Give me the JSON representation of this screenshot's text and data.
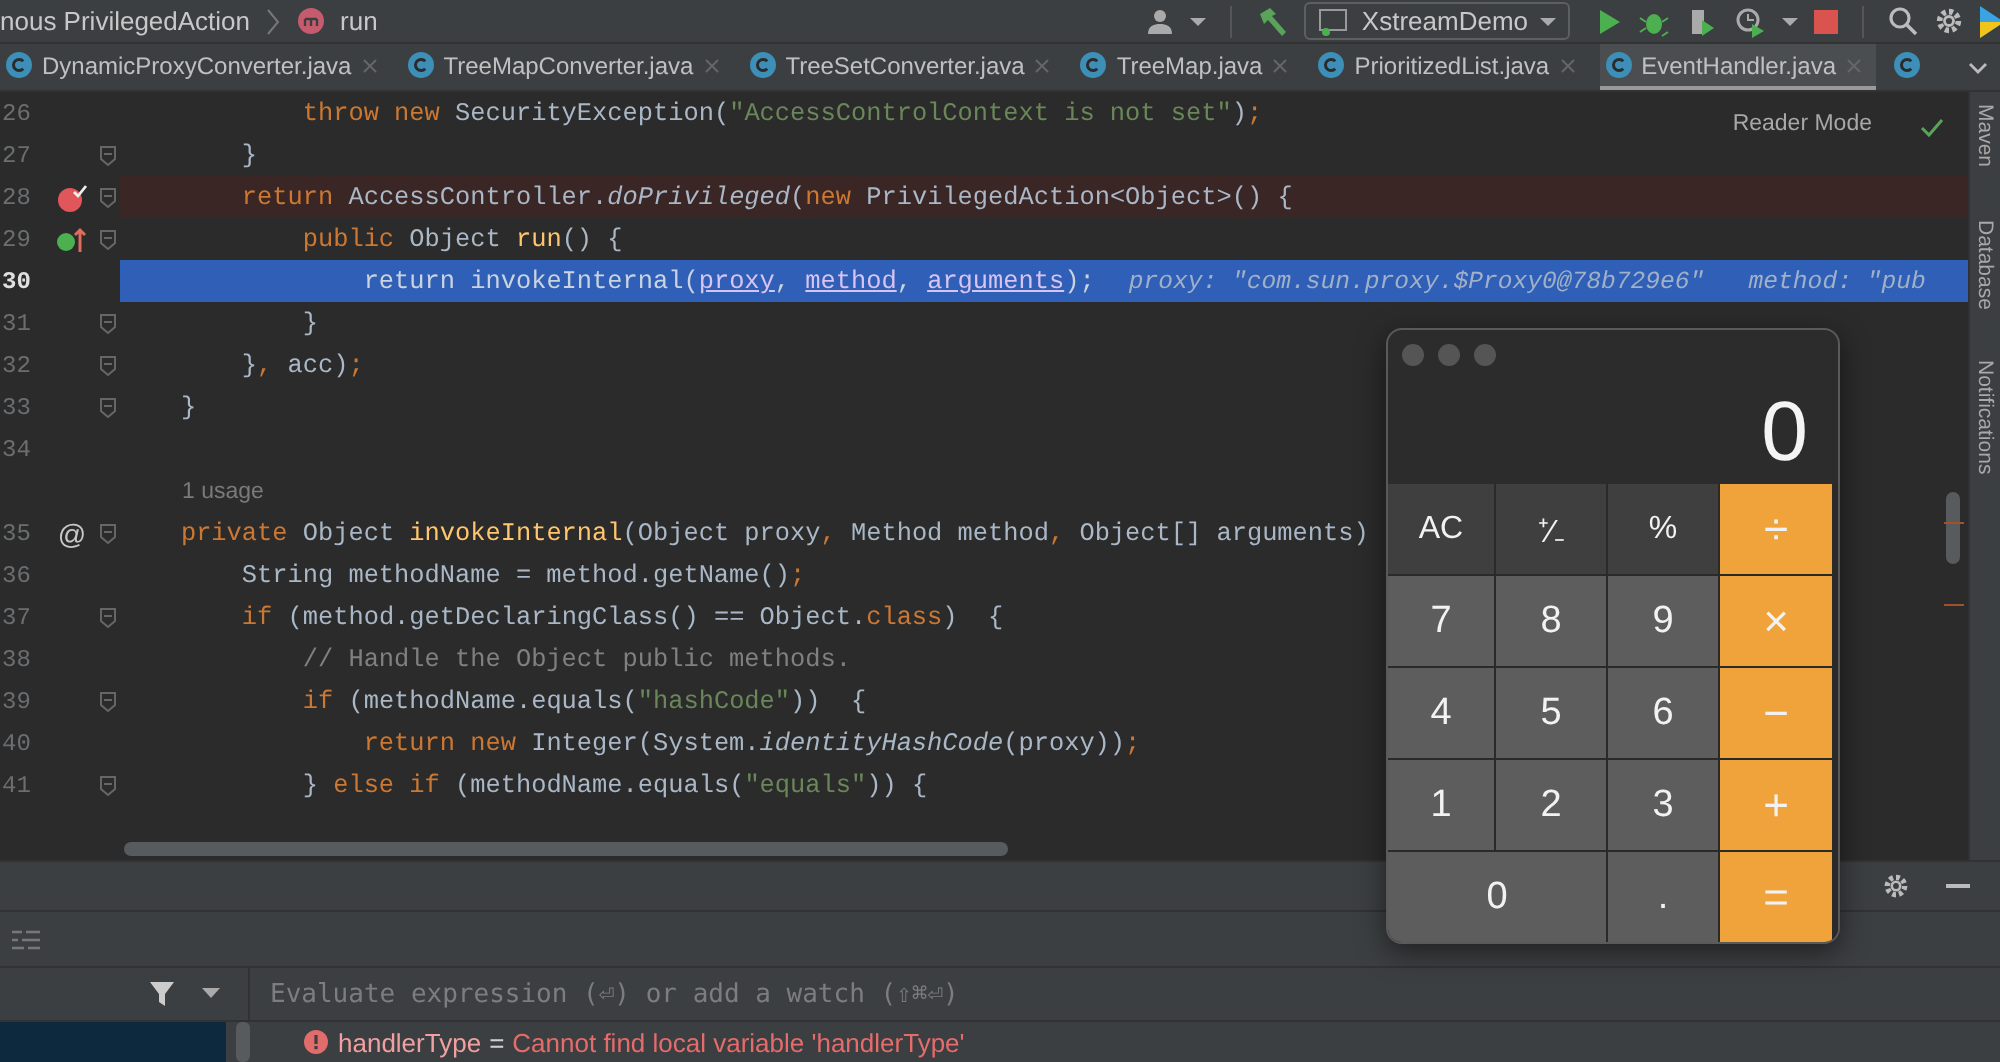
{
  "breadcrumb": [
    "nous PrivilegedAction",
    "run"
  ],
  "run_config": "XstreamDemo",
  "tabs": [
    {
      "label": "DynamicProxyConverter.java",
      "selected": false
    },
    {
      "label": "TreeMapConverter.java",
      "selected": false
    },
    {
      "label": "TreeSetConverter.java",
      "selected": false
    },
    {
      "label": "TreeMap.java",
      "selected": false
    },
    {
      "label": "PrioritizedList.java",
      "selected": false
    },
    {
      "label": "EventHandler.java",
      "selected": true
    }
  ],
  "reader_mode": "Reader Mode",
  "lines": [
    {
      "kind": "code",
      "number": "26",
      "fold": false,
      "tokens": [
        {
          "kind": "kw",
          "text": "            throw new "
        },
        {
          "kind": "txt",
          "text": "SecurityException("
        },
        {
          "kind": "str",
          "text": "\"AccessControlContext is not set\""
        },
        {
          "kind": "txt",
          "text": ")"
        },
        {
          "kind": "kw",
          "text": ";"
        }
      ]
    },
    {
      "kind": "code",
      "number": "27",
      "fold": true,
      "tokens": [
        {
          "kind": "txt",
          "text": "        }"
        }
      ]
    },
    {
      "kind": "breakpoint",
      "number": "28",
      "fold": true,
      "gutter": {
        "kind": "breakpoint"
      },
      "tokens": [
        {
          "kind": "kw",
          "text": "        return "
        },
        {
          "kind": "txt",
          "text": "AccessController."
        },
        {
          "kind": "it",
          "text": "doPrivileged"
        },
        {
          "kind": "txt",
          "text": "("
        },
        {
          "kind": "kw",
          "text": "new "
        },
        {
          "kind": "txt",
          "text": "PrivilegedAction<Object>() {"
        }
      ]
    },
    {
      "kind": "code",
      "number": "29",
      "fold": true,
      "gutter": {
        "kind": "override"
      },
      "tokens": [
        {
          "kind": "kw",
          "text": "            public "
        },
        {
          "kind": "txt",
          "text": "Object "
        },
        {
          "kind": "fn",
          "text": "run"
        },
        {
          "kind": "txt",
          "text": "() {"
        }
      ]
    },
    {
      "kind": "execution",
      "number": "30",
      "fold": false,
      "tokens": [
        {
          "kind": "kw",
          "text": "                return "
        },
        {
          "kind": "txt",
          "text": "invokeInternal("
        },
        {
          "kind": "ref",
          "text": "proxy"
        },
        {
          "kind": "kw",
          "text": ", "
        },
        {
          "kind": "ref",
          "text": "method"
        },
        {
          "kind": "kw",
          "text": ", "
        },
        {
          "kind": "ref",
          "text": "arguments"
        },
        {
          "kind": "txt",
          "text": ")"
        },
        {
          "kind": "kw",
          "text": ";"
        }
      ],
      "hint": "proxy: \"com.sun.proxy.$Proxy0@78b729e6\"   method: \"pub"
    },
    {
      "kind": "code",
      "number": "31",
      "fold": true,
      "tokens": [
        {
          "kind": "txt",
          "text": "            }"
        }
      ]
    },
    {
      "kind": "code",
      "number": "32",
      "fold": true,
      "tokens": [
        {
          "kind": "txt",
          "text": "        }"
        },
        {
          "kind": "kw",
          "text": ", "
        },
        {
          "kind": "txt",
          "text": "acc)"
        },
        {
          "kind": "kw",
          "text": ";"
        }
      ]
    },
    {
      "kind": "code",
      "number": "33",
      "fold": true,
      "tokens": [
        {
          "kind": "txt",
          "text": "    }"
        }
      ]
    },
    {
      "kind": "code",
      "number": "34",
      "fold": false
    },
    {
      "kind": "usage",
      "text": "1 usage"
    },
    {
      "kind": "code",
      "number": "35",
      "fold": true,
      "marker": "@",
      "tokens": [
        {
          "kind": "kw",
          "text": "    private "
        },
        {
          "kind": "txt",
          "text": "Object "
        },
        {
          "kind": "fn",
          "text": "invokeInternal"
        },
        {
          "kind": "txt",
          "text": "(Object proxy"
        },
        {
          "kind": "kw",
          "text": ", "
        },
        {
          "kind": "txt",
          "text": "Method method"
        },
        {
          "kind": "kw",
          "text": ", "
        },
        {
          "kind": "txt",
          "text": "Object[] arguments)"
        }
      ]
    },
    {
      "kind": "code",
      "number": "36",
      "fold": false,
      "tokens": [
        {
          "kind": "txt",
          "text": "        String methodName = method.getName()"
        },
        {
          "kind": "kw",
          "text": ";"
        }
      ]
    },
    {
      "kind": "code",
      "number": "37",
      "fold": true,
      "tokens": [
        {
          "kind": "kw",
          "text": "        if "
        },
        {
          "kind": "txt",
          "text": "(method.getDeclaringClass() == Object."
        },
        {
          "kind": "kw",
          "text": "class"
        },
        {
          "kind": "txt",
          "text": ")  {"
        }
      ]
    },
    {
      "kind": "code",
      "number": "38",
      "fold": false,
      "tokens": [
        {
          "kind": "cmt",
          "text": "            // Handle the Object public methods."
        }
      ]
    },
    {
      "kind": "code",
      "number": "39",
      "fold": true,
      "tokens": [
        {
          "kind": "kw",
          "text": "            if "
        },
        {
          "kind": "txt",
          "text": "(methodName.equals("
        },
        {
          "kind": "str",
          "text": "\"hashCode\""
        },
        {
          "kind": "txt",
          "text": "))  {"
        }
      ]
    },
    {
      "kind": "code",
      "number": "40",
      "fold": false,
      "tokens": [
        {
          "kind": "kw",
          "text": "                return new "
        },
        {
          "kind": "txt",
          "text": "Integer(System."
        },
        {
          "kind": "it",
          "text": "identityHashCode"
        },
        {
          "kind": "txt",
          "text": "(proxy))"
        },
        {
          "kind": "kw",
          "text": ";"
        }
      ]
    },
    {
      "kind": "code",
      "number": "41",
      "fold": true,
      "tokens": [
        {
          "kind": "txt",
          "text": "            } "
        },
        {
          "kind": "kw",
          "text": "else if "
        },
        {
          "kind": "txt",
          "text": "(methodName.equals("
        },
        {
          "kind": "str",
          "text": "\"equals\""
        },
        {
          "kind": "txt",
          "text": ")) {"
        }
      ]
    }
  ],
  "side_tools": [
    "Maven",
    "Database",
    "Notifications"
  ],
  "evaluate": {
    "placeholder": "Evaluate expression (⏎) or add a watch (⇧⌘⏎)"
  },
  "watch": {
    "name": "handlerType",
    "separator": "=",
    "value": "Cannot find local variable 'handlerType'"
  },
  "calculator": {
    "display": "0",
    "buttons": [
      {
        "label": "AC",
        "kind": "func"
      },
      {
        "label": "⁺∕₋",
        "kind": "func"
      },
      {
        "label": "%",
        "kind": "func"
      },
      {
        "label": "÷",
        "kind": "op"
      },
      {
        "label": "7",
        "kind": "digit"
      },
      {
        "label": "8",
        "kind": "digit"
      },
      {
        "label": "9",
        "kind": "digit"
      },
      {
        "label": "×",
        "kind": "op"
      },
      {
        "label": "4",
        "kind": "digit"
      },
      {
        "label": "5",
        "kind": "digit"
      },
      {
        "label": "6",
        "kind": "digit"
      },
      {
        "label": "−",
        "kind": "op"
      },
      {
        "label": "1",
        "kind": "digit"
      },
      {
        "label": "2",
        "kind": "digit"
      },
      {
        "label": "3",
        "kind": "digit"
      },
      {
        "label": "+",
        "kind": "op"
      },
      {
        "label": "0",
        "kind": "wide-digit"
      },
      {
        "label": ".",
        "kind": "digit"
      },
      {
        "label": "=",
        "kind": "op"
      }
    ]
  }
}
